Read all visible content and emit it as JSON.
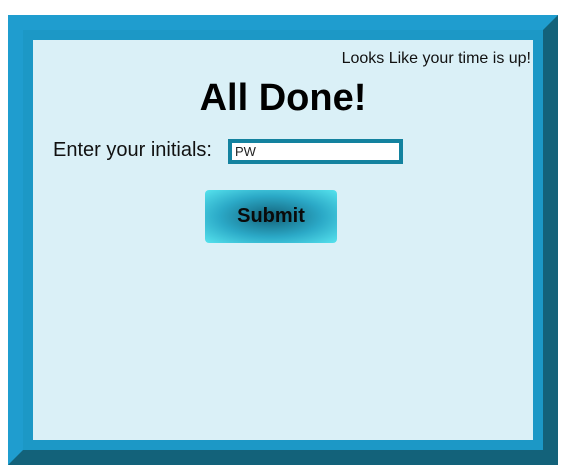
{
  "timer": {
    "message": "Looks Like your time is up!"
  },
  "page": {
    "title": "All Done!"
  },
  "form": {
    "initials_label": "Enter your initials:",
    "initials_value": "PW",
    "submit_label": "Submit"
  },
  "colors": {
    "frame_outer": "#13627a",
    "frame_inner": "#1c98c6",
    "panel_background": "#daf0f7",
    "input_border": "#13829f",
    "button_gradient_center": "#13627a",
    "button_gradient_edge": "#56e3ee"
  }
}
